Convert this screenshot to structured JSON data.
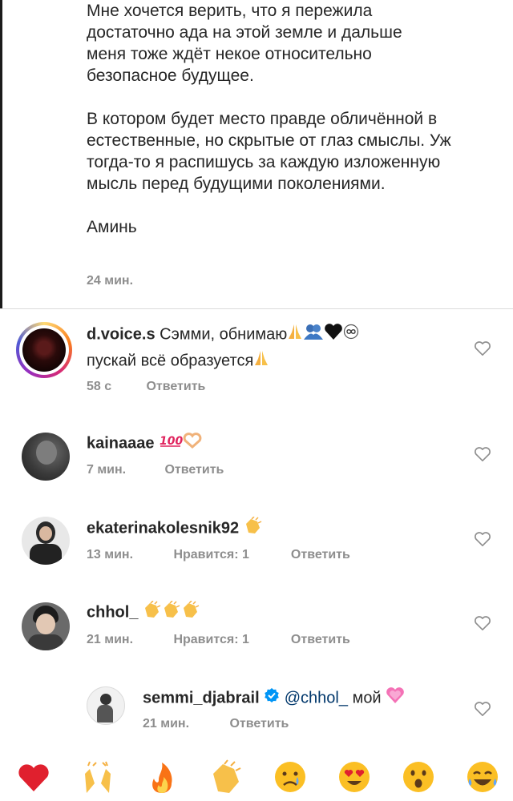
{
  "caption": {
    "paragraph1": "Мне хочется верить, что я пережила достаточно ада на этой земле и дальше меня тоже ждёт некое относительно безопасное будущее.",
    "paragraph2": "В котором будет место правде обличённой в естественные, но скрытые от глаз смыслы. Уж тогда-то я распишусь за каждую изложенную мысль перед будущими поколениями.",
    "paragraph3": "Аминь",
    "time": "24 мин."
  },
  "comments": [
    {
      "username": "d.voice.s",
      "line1": "Сэмми, обнимаю",
      "line2": "пускай всё образуется",
      "time": "58 с",
      "reply": "Ответить",
      "icons": [
        "pray-icon",
        "hug-icon",
        "black-heart-icon",
        "infinity-icon"
      ]
    },
    {
      "username": "kainaaae",
      "text": "",
      "time": "7 мин.",
      "reply": "Ответить",
      "icons": [
        "hundred-icon",
        "heart-hands-icon"
      ]
    },
    {
      "username": "ekaterinakolesnik92",
      "text": "",
      "time": "13 мин.",
      "likes": "Нравится: 1",
      "reply": "Ответить",
      "icons": [
        "clap-icon"
      ]
    },
    {
      "username": "chhol_",
      "text": "",
      "time": "21 мин.",
      "likes": "Нравится: 1",
      "reply": "Ответить",
      "icons": [
        "clap-icon",
        "clap-icon",
        "clap-icon"
      ]
    },
    {
      "username": "semmi_djabrail",
      "mention": "@chhol_",
      "text": "мой",
      "time": "21 мин.",
      "reply": "Ответить",
      "verified": true,
      "icons": [
        "growing-heart-icon"
      ]
    }
  ],
  "reactions": [
    "red-heart-icon",
    "raised-hands-icon",
    "fire-icon",
    "clap-icon",
    "crying-face-icon",
    "heart-eyes-icon",
    "surprised-face-icon",
    "laughing-face-icon"
  ],
  "colors": {
    "text": "#262626",
    "meta": "#8e8e8e",
    "mention": "#00376b",
    "verified": "#0095f6",
    "story_ring_start": "#feda75",
    "story_ring_end": "#d62976"
  }
}
